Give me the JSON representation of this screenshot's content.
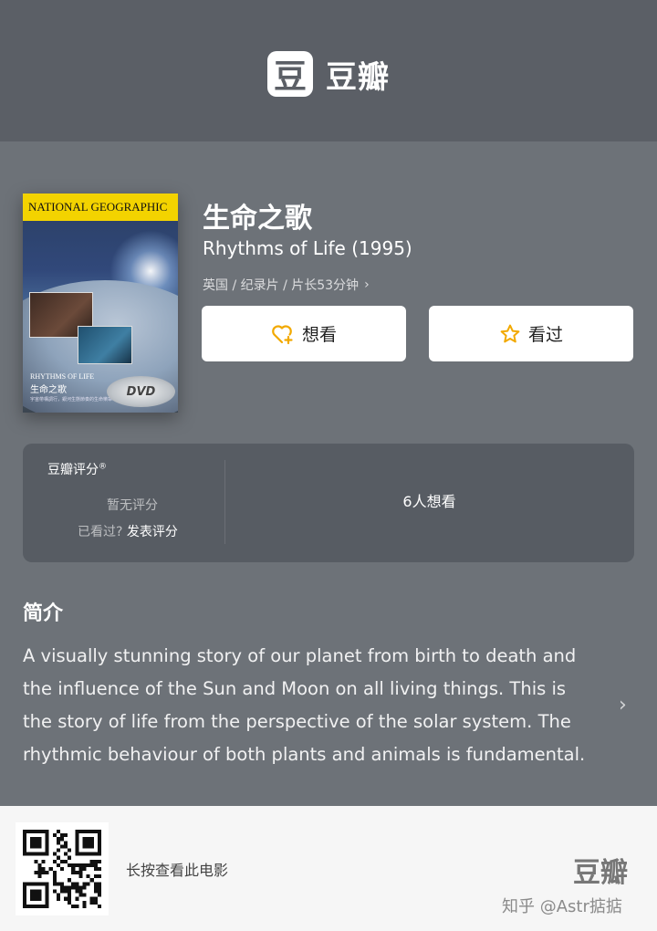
{
  "header": {
    "logo_mark": "豆",
    "logo_text": "豆瓣"
  },
  "poster": {
    "brand": "NATIONAL GEOGRAPHIC",
    "caption_en": "RHYTHMS OF LIFE",
    "caption_cn": "生命之歌",
    "caption_small": "宇宙帶構調行，銀河生態節奏的生命樂章",
    "dvd": "DVD"
  },
  "movie": {
    "title_cn": "生命之歌",
    "title_en": "Rhythms of Life (1995)",
    "meta": "英国 / 纪录片 / 片长53分钟",
    "meta_chevron": "›"
  },
  "actions": {
    "want_label": "想看",
    "seen_label": "看过"
  },
  "rating": {
    "title": "豆瓣评分",
    "title_mark": "®",
    "none": "暂无评分",
    "seen_prompt": "已看过?",
    "seen_action": "发表评分",
    "want_count": "6人想看"
  },
  "intro": {
    "title": "简介",
    "text": "A visually stunning story of our planet from birth to death and the influence of the Sun and Moon on all living things. This is the story of life from the perspective of the solar system. The rhythmic behaviour of both plants and animals is fundamental.",
    "chevron": "›"
  },
  "footer": {
    "text": "长按查看此电影",
    "logo": "豆瓣",
    "watermark": "知乎 @Astr掂掂"
  },
  "colors": {
    "header_bg": "#5b5f66",
    "page_bg": "#6d7278",
    "card_bg": "#575c63",
    "accent": "#f2a900"
  }
}
